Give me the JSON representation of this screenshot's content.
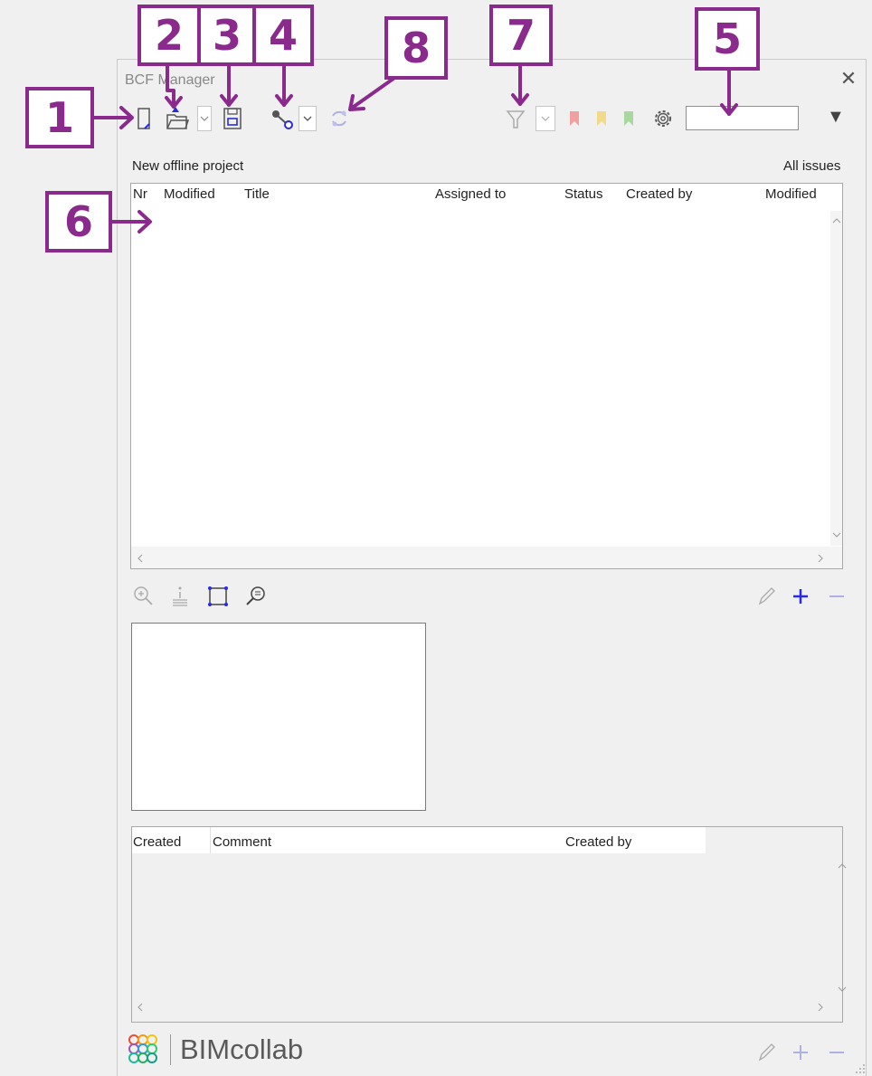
{
  "window": {
    "title": "BCF Manager",
    "close_glyph": "✕"
  },
  "callouts": [
    "1",
    "2",
    "3",
    "4",
    "5",
    "6",
    "7",
    "8"
  ],
  "toolbar": {
    "icons": [
      "new-document-icon",
      "open-folder-icon",
      "save-icon",
      "connect-icon",
      "sync-icon",
      "filter-icon",
      "bookmark-red-icon",
      "bookmark-yellow-icon",
      "bookmark-green-icon",
      "gear-icon"
    ],
    "search_value": "",
    "menu_glyph": "▼"
  },
  "project": {
    "name": "New offline project",
    "filter_label": "All issues"
  },
  "issues_table": {
    "columns": [
      "Nr",
      "Modified",
      "Title",
      "Assigned to",
      "Status",
      "Created by",
      "Modified"
    ],
    "rows": []
  },
  "viewpoint_toolbar": {
    "icons": [
      "zoom-in-icon",
      "info-icon",
      "select-box-icon",
      "search-icon",
      "pencil-icon",
      "plus-icon",
      "minus-icon"
    ]
  },
  "comments_table": {
    "columns": [
      "Created",
      "Comment",
      "Created by"
    ],
    "rows": []
  },
  "footer": {
    "logo_text": "BIMcollab"
  },
  "colors": {
    "accent": "#8a2a8c",
    "blue": "#2a2ae0"
  }
}
